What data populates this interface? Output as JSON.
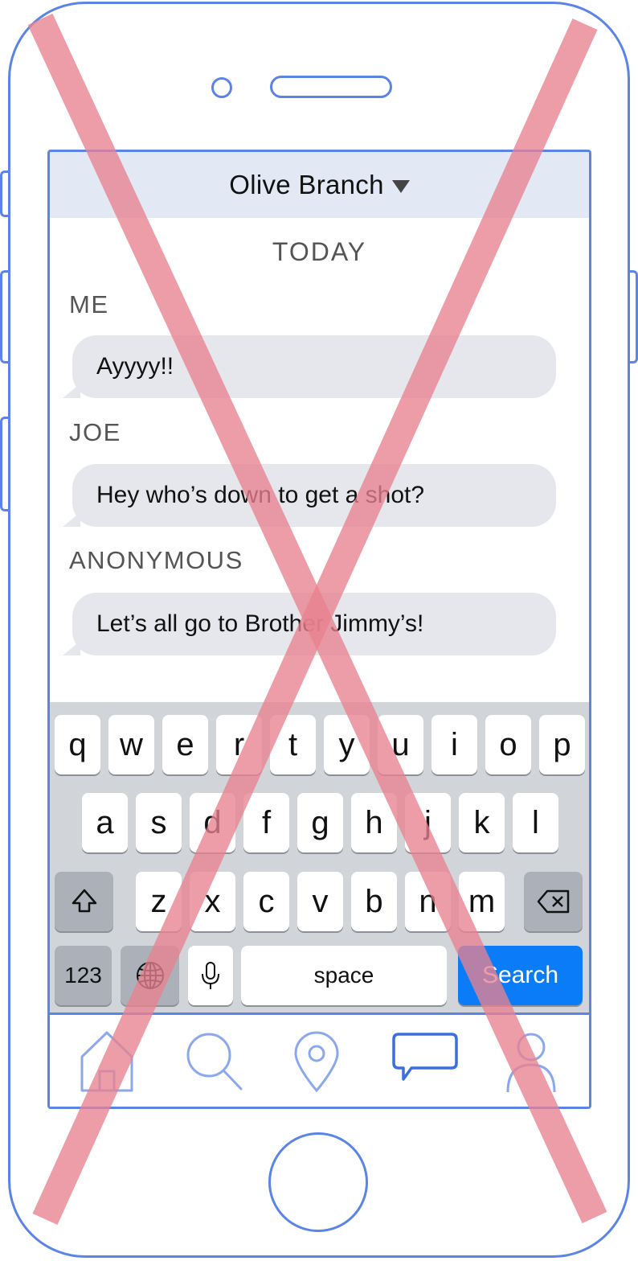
{
  "header": {
    "title": "Olive Branch"
  },
  "chat": {
    "day_label": "TODAY",
    "messages": [
      {
        "sender": "ME",
        "text": "Ayyyy!!"
      },
      {
        "sender": "JOE",
        "text": "Hey who’s down to get a shot?"
      },
      {
        "sender": "ANONYMOUS",
        "text": "Let’s all go to Brother Jimmy’s!"
      }
    ]
  },
  "keyboard": {
    "row1": [
      "q",
      "w",
      "e",
      "r",
      "t",
      "y",
      "u",
      "i",
      "o",
      "p"
    ],
    "row2": [
      "a",
      "s",
      "d",
      "f",
      "g",
      "h",
      "j",
      "k",
      "l"
    ],
    "row3": [
      "z",
      "x",
      "c",
      "v",
      "b",
      "n",
      "m"
    ],
    "numbers_label": "123",
    "space_label": "space",
    "search_label": "Search"
  },
  "tabs": [
    {
      "icon": "home-icon"
    },
    {
      "icon": "search-icon"
    },
    {
      "icon": "location-pin-icon"
    },
    {
      "icon": "chat-bubble-icon"
    },
    {
      "icon": "profile-icon"
    }
  ],
  "colors": {
    "accent": "#5b84e6",
    "header_bg": "#e2e8f4",
    "bubble": "#e6e7ec",
    "search_key": "#0a7cf8",
    "cross": "#e8828f"
  }
}
